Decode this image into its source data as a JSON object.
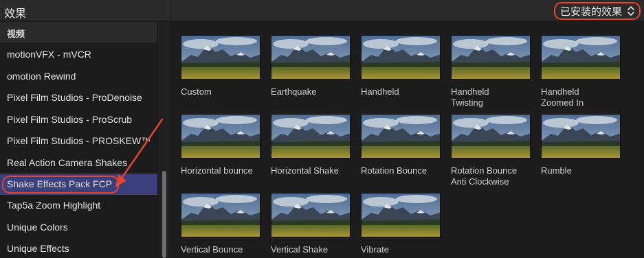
{
  "header": {
    "title": "效果",
    "installed_filter": "已安装的效果"
  },
  "sidebar": {
    "category": "视频",
    "items": [
      {
        "label": "motionVFX - mVCR"
      },
      {
        "label": "omotion Rewind"
      },
      {
        "label": "Pixel Film Studios - ProDenoise"
      },
      {
        "label": "Pixel Film Studios - ProScrub"
      },
      {
        "label": "Pixel Film Studios - PROSKEW™"
      },
      {
        "label": "Real Action Camera Shakes"
      },
      {
        "label": "Shake Effects Pack FCP",
        "selected": true
      },
      {
        "label": "Tap5a Zoom Highlight"
      },
      {
        "label": "Unique Colors"
      },
      {
        "label": "Unique Effects"
      }
    ]
  },
  "effects": [
    {
      "label": "Custom"
    },
    {
      "label": "Earthquake"
    },
    {
      "label": "Handheld"
    },
    {
      "label": "Handheld\nTwisting"
    },
    {
      "label": "Handheld\nZoomed In"
    },
    {
      "label": "Horizontal bounce"
    },
    {
      "label": "Horizontal Shake"
    },
    {
      "label": "Rotation Bounce"
    },
    {
      "label": "Rotation Bounce\nAnti Clockwise"
    },
    {
      "label": "Rumble"
    },
    {
      "label": "Vertical Bounce"
    },
    {
      "label": "Vertical Shake"
    },
    {
      "label": "Vibrate"
    }
  ],
  "colors": {
    "accent_annotation": "#e3452f",
    "selection": "#3c3f7e"
  }
}
